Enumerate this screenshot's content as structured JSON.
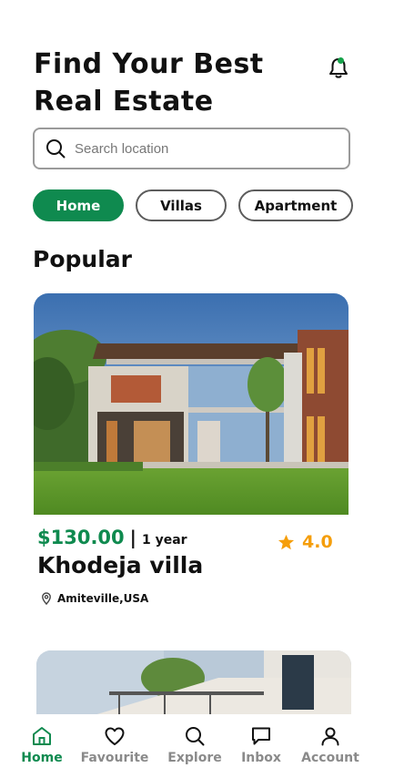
{
  "header": {
    "title_line1": "Find Your Best",
    "title_line2": "Real Estate"
  },
  "search": {
    "placeholder": "Search location",
    "value": ""
  },
  "filters": {
    "chips": [
      {
        "label": "Home",
        "active": true
      },
      {
        "label": "Villas",
        "active": false
      },
      {
        "label": "Apartment",
        "active": false
      }
    ]
  },
  "popular": {
    "section_title": "Popular",
    "listings": [
      {
        "price": "$130.00",
        "separator": "|",
        "period": "1 year",
        "rating": "4.0",
        "name": "Khodeja villa",
        "location": "Amiteville,USA"
      }
    ]
  },
  "bottom_nav": {
    "items": [
      {
        "label": "Home",
        "icon": "home-icon",
        "active": true
      },
      {
        "label": "Favourite",
        "icon": "heart-icon",
        "active": false
      },
      {
        "label": "Explore",
        "icon": "search-icon",
        "active": false
      },
      {
        "label": "Inbox",
        "icon": "chat-icon",
        "active": false
      },
      {
        "label": "Account",
        "icon": "user-icon",
        "active": false
      }
    ]
  },
  "colors": {
    "accent": "#0f8a4f",
    "rating": "#f59e0b",
    "notification_dot": "#16a34a"
  }
}
